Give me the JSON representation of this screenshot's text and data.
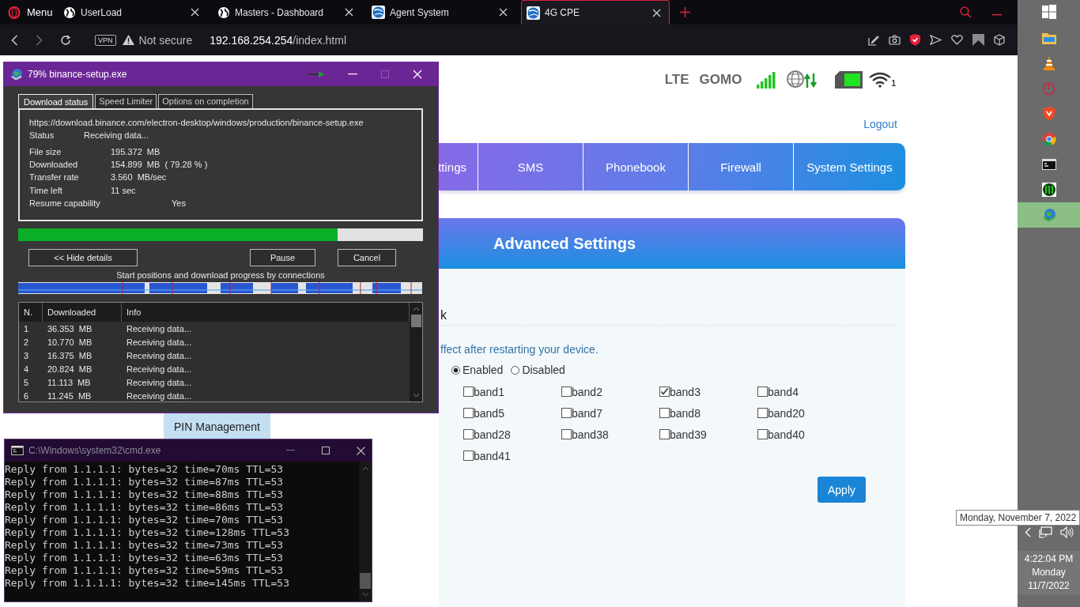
{
  "browser": {
    "menu_label": "Menu",
    "tabs": [
      {
        "title": "UserLoad",
        "kind": "globe",
        "selected": false
      },
      {
        "title": "Masters - Dashboard",
        "kind": "globe",
        "selected": false
      },
      {
        "title": "Agent System",
        "kind": "blue",
        "selected": false
      },
      {
        "title": "4G CPE",
        "kind": "blue",
        "selected": true
      }
    ],
    "vpn": "VPN",
    "security": "Not secure",
    "url_host": "192.168.254.254",
    "url_path": "/index.html"
  },
  "router_page": {
    "network_type": "LTE",
    "operator": "GOMO",
    "wifi_clients": "1",
    "logout": "Logout",
    "nav": [
      {
        "label": "ttings"
      },
      {
        "label": "SMS"
      },
      {
        "label": "Phonebook"
      },
      {
        "label": "Firewall"
      },
      {
        "label": "System Settings"
      }
    ],
    "sidebar": [
      {
        "label": "PIN Management"
      }
    ],
    "panel_title": "Advanced Settings",
    "section_title": "k",
    "note": "ffect after restarting your device.",
    "band_lock": [
      {
        "label": "Enabled",
        "selected": true
      },
      {
        "label": "Disabled",
        "selected": false
      }
    ],
    "bands": [
      {
        "label": "band1",
        "checked": false
      },
      {
        "label": "band2",
        "checked": false
      },
      {
        "label": "band3",
        "checked": true
      },
      {
        "label": "band4",
        "checked": false
      },
      {
        "label": "band5",
        "checked": false
      },
      {
        "label": "band7",
        "checked": false
      },
      {
        "label": "band8",
        "checked": false
      },
      {
        "label": "band20",
        "checked": false
      },
      {
        "label": "band28",
        "checked": false
      },
      {
        "label": "band38",
        "checked": false
      },
      {
        "label": "band39",
        "checked": false
      },
      {
        "label": "band40",
        "checked": false
      },
      {
        "label": "band41",
        "checked": false
      }
    ],
    "apply": "Apply"
  },
  "download_window": {
    "title": "79% binance-setup.exe",
    "tabs": [
      {
        "label": "Download status",
        "selected": true
      },
      {
        "label": "Speed Limiter",
        "selected": false
      },
      {
        "label": "Options on completion",
        "selected": false
      }
    ],
    "url": "https://download.binance.com/electron-desktop/windows/production/binance-setup.exe",
    "status": {
      "label": "Status",
      "value": "Receiving data..."
    },
    "details": [
      {
        "label": "File size",
        "value": "195.372  MB"
      },
      {
        "label": "Downloaded",
        "value": "154.899  MB  ( 79.28 % )"
      },
      {
        "label": "Transfer rate",
        "value": "3.560  MB/sec"
      },
      {
        "label": "Time left",
        "value": "11 sec"
      },
      {
        "label": "Resume capability",
        "value": "Yes"
      }
    ],
    "progress": {
      "level": 0.79
    },
    "buttons": [
      "<< Hide details",
      "Pause",
      "Cancel"
    ],
    "connections_label": "Start positions and download progress by connections",
    "table": {
      "columns": [
        "N.",
        "Downloaded",
        "Info"
      ],
      "rows": [
        [
          "1",
          "36.353  MB",
          "Receiving data..."
        ],
        [
          "2",
          "10.770  MB",
          "Receiving data..."
        ],
        [
          "3",
          "16.375  MB",
          "Receiving data..."
        ],
        [
          "4",
          "20.824  MB",
          "Receiving data..."
        ],
        [
          "5",
          "11.113  MB",
          "Receiving data..."
        ],
        [
          "6",
          "11.245  MB",
          "Receiving data..."
        ]
      ]
    }
  },
  "cmd_window": {
    "title": "C:\\Windows\\system32\\cmd.exe",
    "lines": [
      "Reply from 1.1.1.1: bytes=32 time=70ms TTL=53",
      "Reply from 1.1.1.1: bytes=32 time=87ms TTL=53",
      "Reply from 1.1.1.1: bytes=32 time=88ms TTL=53",
      "Reply from 1.1.1.1: bytes=32 time=86ms TTL=53",
      "Reply from 1.1.1.1: bytes=32 time=70ms TTL=53",
      "Reply from 1.1.1.1: bytes=32 time=128ms TTL=53",
      "Reply from 1.1.1.1: bytes=32 time=73ms TTL=53",
      "Reply from 1.1.1.1: bytes=32 time=63ms TTL=53",
      "Reply from 1.1.1.1: bytes=32 time=59ms TTL=53",
      "Reply from 1.1.1.1: bytes=32 time=145ms TTL=53"
    ]
  },
  "taskbar": {
    "apps": [
      {
        "kind": "folder",
        "selected": false
      },
      {
        "kind": "cone",
        "selected": false
      },
      {
        "kind": "ring",
        "selected": false
      },
      {
        "kind": "lion",
        "selected": false
      },
      {
        "kind": "chrome",
        "selected": false
      },
      {
        "kind": "console",
        "selected": false
      },
      {
        "kind": "matrix",
        "selected": false
      },
      {
        "kind": "globe",
        "selected": true
      }
    ],
    "tooltip": "Monday, November 7, 2022",
    "time": "4:22:04 PM",
    "day": "Monday",
    "date": "11/7/2022"
  }
}
